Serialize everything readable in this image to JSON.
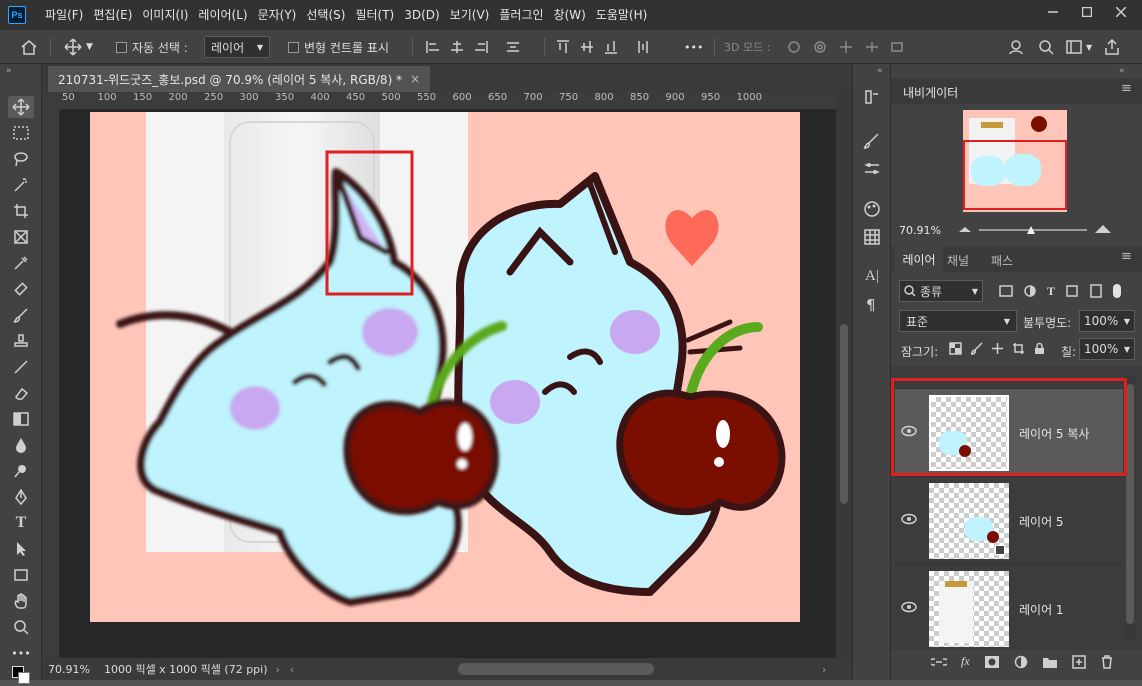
{
  "app": {
    "logo": "Ps"
  },
  "menu": [
    "파일(F)",
    "편집(E)",
    "이미지(I)",
    "레이어(L)",
    "문자(Y)",
    "선택(S)",
    "필터(T)",
    "3D(D)",
    "보기(V)",
    "플러그인",
    "창(W)",
    "도움말(H)"
  ],
  "options": {
    "auto_select_label": "자동 선택 :",
    "auto_select_value": "레이어",
    "transform_label": "변형 컨트롤 표시",
    "mode_3d_label": "3D 모드 :",
    "more": "•••"
  },
  "document": {
    "tab_title": "210731-위드굿즈_홍보.psd @ 70.9% (레이어 5 복사, RGB/8) *",
    "close": "×",
    "ruler_ticks": [
      "50",
      "100",
      "150",
      "200",
      "250",
      "300",
      "350",
      "400",
      "450",
      "500",
      "550",
      "600",
      "650",
      "700",
      "750",
      "800",
      "850",
      "900",
      "950",
      "1000"
    ],
    "zoom": "70.91%",
    "size_info": "1000 픽셀 x 1000 픽셀 (72 ppi)"
  },
  "navigator": {
    "title": "내비게이터",
    "zoom": "70.91%"
  },
  "layers_panel": {
    "tabs": [
      "레이어",
      "채널",
      "패스"
    ],
    "filter_label": "종류",
    "blend_mode": "표준",
    "opacity_label": "불투명도:",
    "opacity_value": "100%",
    "lock_label": "잠그기:",
    "fill_label": "칠:",
    "fill_value": "100%",
    "layers": [
      {
        "name": "레이어 5 복사",
        "selected": true
      },
      {
        "name": "레이어 5",
        "selected": false
      },
      {
        "name": "레이어 1",
        "selected": false
      }
    ]
  },
  "colors": {
    "accent": "#31a8ff",
    "artboard": "#ffc5b9",
    "cat": "#bff3fd",
    "cherry": "#7a0e00",
    "highlight_box": "#e02020"
  }
}
